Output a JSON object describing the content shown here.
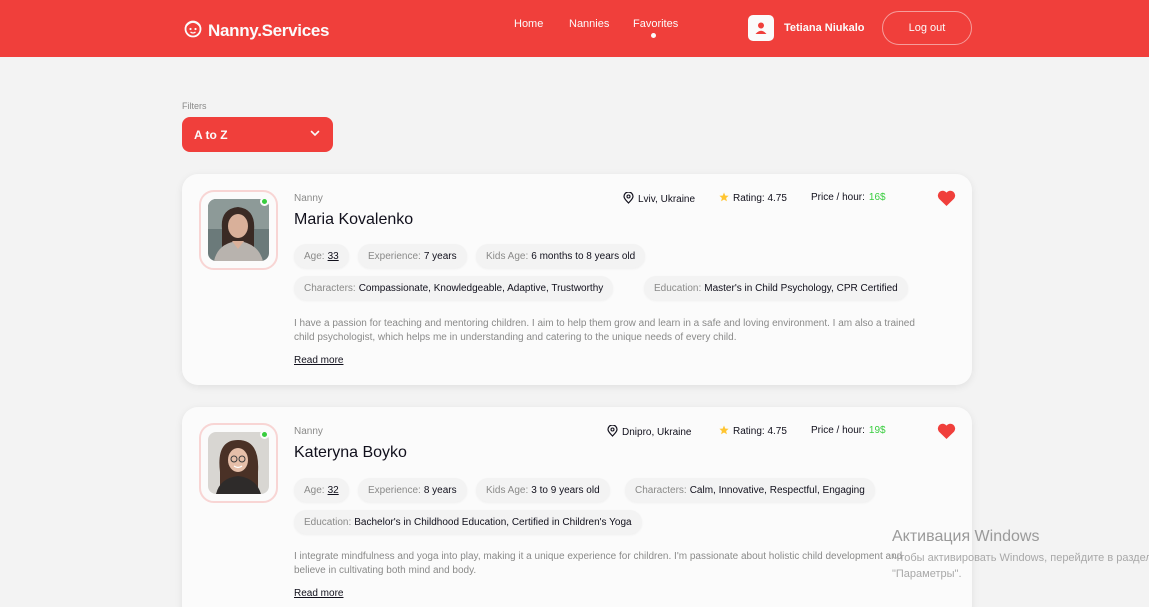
{
  "header": {
    "logo": "Nanny.Services",
    "nav": [
      "Home",
      "Nannies",
      "Favorites"
    ],
    "active_nav": "Favorites",
    "user_name": "Tetiana Niukalo",
    "logout_label": "Log out"
  },
  "filters": {
    "label": "Filters",
    "selected": "A to Z"
  },
  "cards": [
    {
      "role": "Nanny",
      "name": "Maria Kovalenko",
      "location": "Lviv, Ukraine",
      "rating": "Rating: 4.75",
      "price_label": "Price / hour:",
      "price_value": "16$",
      "chips": [
        {
          "k": "Age:",
          "v": "33"
        },
        {
          "k": "Experience:",
          "v": "7 years"
        },
        {
          "k": "Kids Age:",
          "v": "6 months to 8 years old"
        },
        {
          "k": "Characters:",
          "v": "Compassionate, Knowledgeable, Adaptive, Trustworthy"
        },
        {
          "k": "Education:",
          "v": "Master's in Child Psychology, CPR Certified"
        }
      ],
      "description": "I have a passion for teaching and mentoring children. I aim to help them grow and learn in a safe and loving environment. I am also a trained child psychologist, which helps me in understanding and catering to the unique needs of every child.",
      "read_more": "Read more"
    },
    {
      "role": "Nanny",
      "name": "Kateryna Boyko",
      "location": "Dnipro, Ukraine",
      "rating": "Rating: 4.75",
      "price_label": "Price / hour:",
      "price_value": "19$",
      "chips": [
        {
          "k": "Age:",
          "v": "32"
        },
        {
          "k": "Experience:",
          "v": "8 years"
        },
        {
          "k": "Kids Age:",
          "v": "3 to 9 years old"
        },
        {
          "k": "Characters:",
          "v": "Calm, Innovative, Respectful, Engaging"
        },
        {
          "k": "Education:",
          "v": "Bachelor's in Childhood Education, Certified in Children's Yoga"
        }
      ],
      "description": "I integrate mindfulness and yoga into play, making it a unique experience for children. I'm passionate about holistic child development and believe in cultivating both mind and body.",
      "read_more": "Read more"
    }
  ],
  "watermark": {
    "title": "Активация Windows",
    "line1": "Чтобы активировать Windows, перейдите в раздел",
    "line2": "\"Параметры\"."
  },
  "colors": {
    "brand": "#f03f3b",
    "online": "#38cd3e",
    "star": "#ffc531"
  }
}
